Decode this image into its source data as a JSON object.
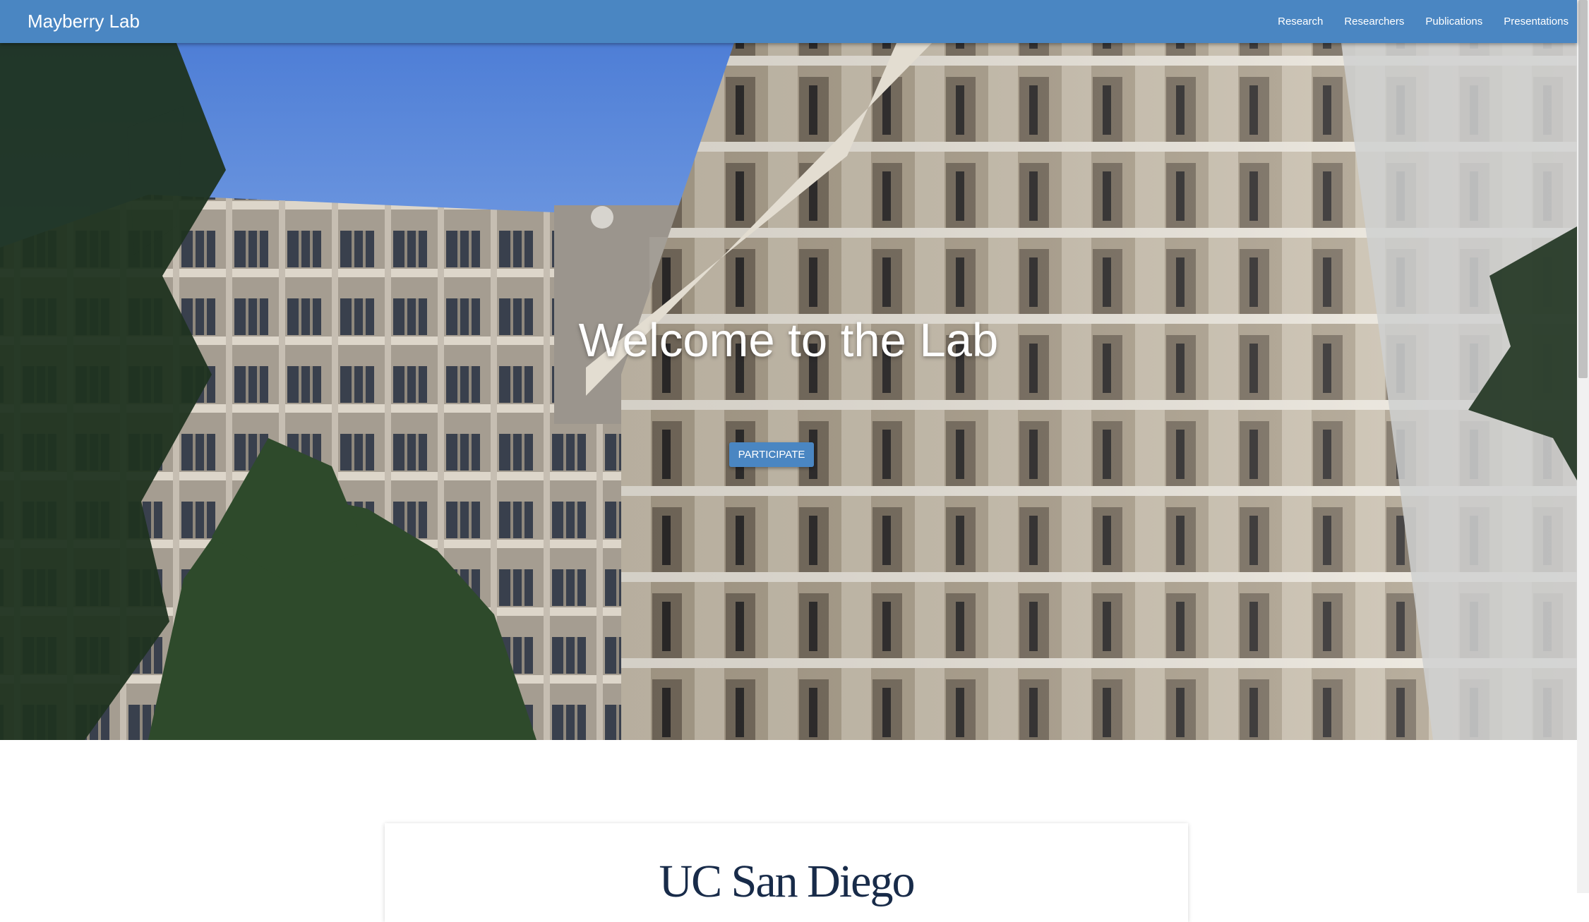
{
  "navbar": {
    "brand": "Mayberry Lab",
    "links": [
      {
        "label": "Research"
      },
      {
        "label": "Researchers"
      },
      {
        "label": "Publications"
      },
      {
        "label": "Presentations"
      }
    ]
  },
  "hero": {
    "title": "Welcome to the Lab",
    "button_label": "PARTICIPATE"
  },
  "card": {
    "logo_text": "UC San Diego"
  },
  "colors": {
    "accent": "#4a86c2",
    "logo": "#182b49"
  }
}
